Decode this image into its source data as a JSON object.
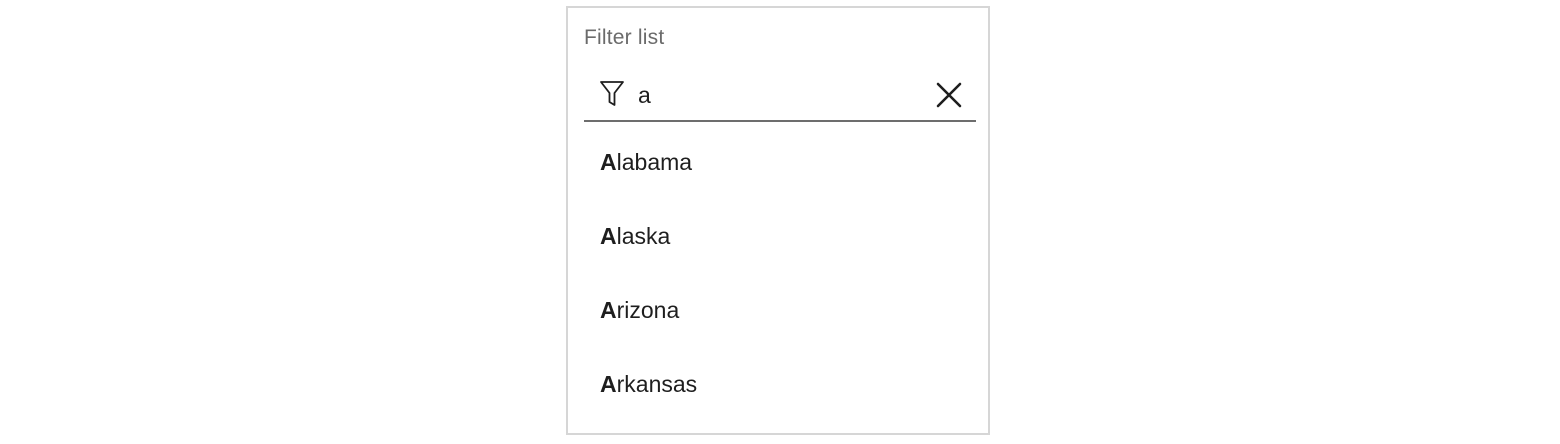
{
  "filter": {
    "label": "Filter list",
    "query": "a",
    "icon": "filter-icon",
    "clear_icon": "close-icon"
  },
  "results": [
    {
      "match": "A",
      "rest": "labama"
    },
    {
      "match": "A",
      "rest": "laska"
    },
    {
      "match": "A",
      "rest": "rizona"
    },
    {
      "match": "A",
      "rest": "rkansas"
    }
  ],
  "colors": {
    "border": "#d6d6d6",
    "label": "#6b6b6b",
    "underline": "#6d6d6d",
    "text": "#1e1e1e"
  }
}
